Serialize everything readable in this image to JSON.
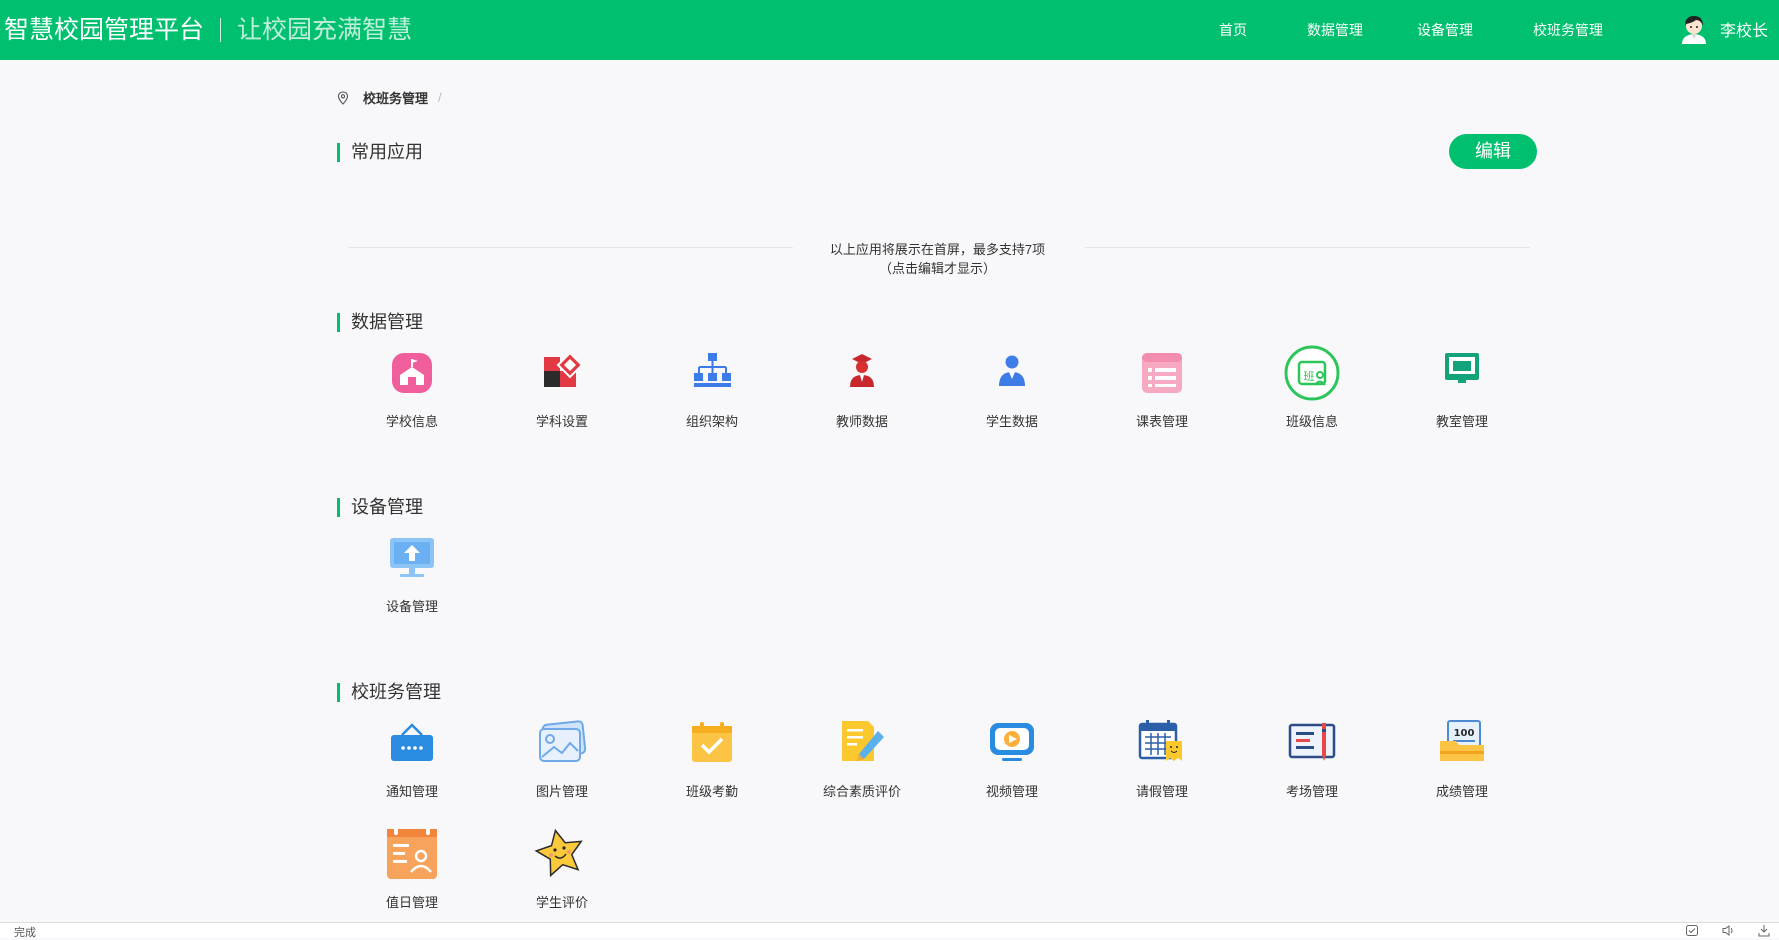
{
  "header": {
    "title": "智慧校园管理平台",
    "slogan": "让校园充满智慧",
    "nav": [
      "首页",
      "数据管理",
      "设备管理",
      "校班务管理"
    ],
    "user_name": "李校长"
  },
  "breadcrumb": {
    "current": "校班务管理",
    "separator": "/"
  },
  "common_apps": {
    "title": "常用应用",
    "edit_label": "编辑",
    "hint_line1": "以上应用将展示在首屏，最多支持7项",
    "hint_line2": "（点击编辑才显示）"
  },
  "sections": [
    {
      "title": "数据管理",
      "apps": [
        "学校信息",
        "学科设置",
        "组织架构",
        "教师数据",
        "学生数据",
        "课表管理",
        "班级信息",
        "教室管理"
      ]
    },
    {
      "title": "设备管理",
      "apps": [
        "设备管理"
      ]
    },
    {
      "title": "校班务管理",
      "apps": [
        "通知管理",
        "图片管理",
        "班级考勤",
        "综合素质评价",
        "视频管理",
        "请假管理",
        "考场管理",
        "成绩管理",
        "值日管理",
        "学生评价"
      ]
    }
  ],
  "icons": {
    "school-info": "school-icon",
    "subject-settings": "subject-icon",
    "org-structure": "org-tree-icon",
    "teacher-data": "teacher-icon",
    "student-data": "student-icon",
    "timetable": "timetable-icon",
    "class-info": "class-badge-icon",
    "classroom": "classroom-board-icon",
    "device": "monitor-upload-icon",
    "notice": "notice-board-icon",
    "picture": "picture-icon",
    "attendance": "calendar-check-icon",
    "quality-eval": "note-pen-icon",
    "video": "video-play-icon",
    "leave": "calendar-leave-icon",
    "exam-room": "exam-card-icon",
    "score": "score-folder-icon",
    "duty": "duty-roster-icon",
    "student-eval": "star-face-icon"
  },
  "colors": {
    "brand": "#00c06f"
  },
  "score_badge": "100",
  "class_badge": "班",
  "statusbar": {
    "text": "完成"
  }
}
